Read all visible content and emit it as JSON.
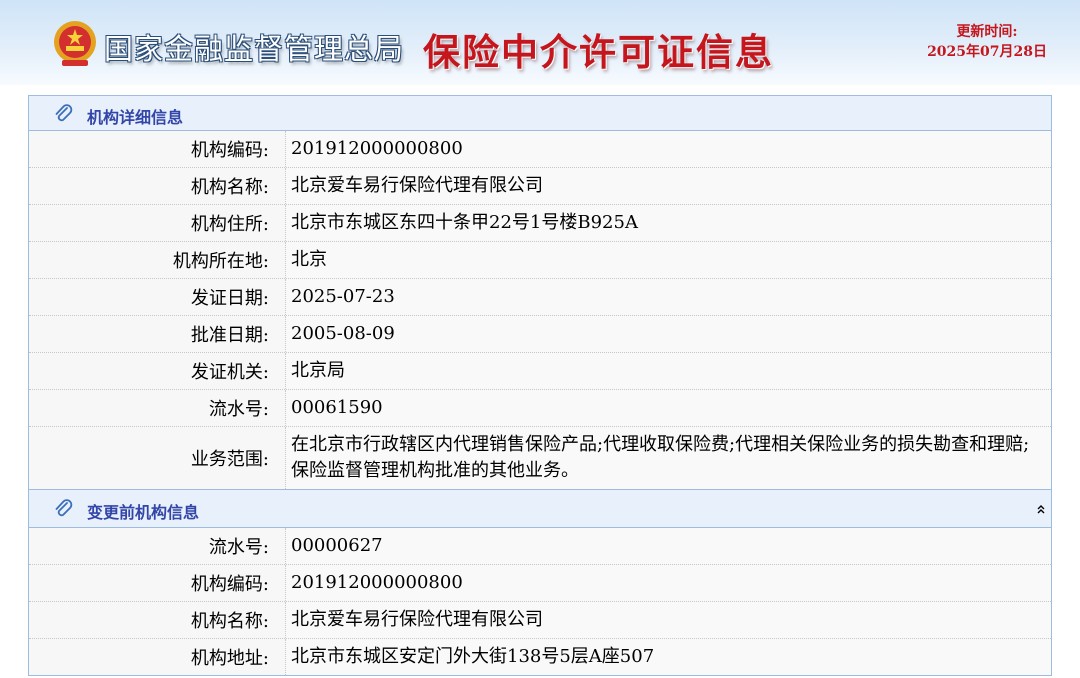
{
  "header": {
    "agency": "国家金融监督管理总局",
    "title": "保险中介许可证信息",
    "update_label": "更新时间:",
    "update_date": "2025年07月28日"
  },
  "detail": {
    "heading": "机构详细信息",
    "rows": [
      {
        "label": "机构编码:",
        "value": "201912000000800"
      },
      {
        "label": "机构名称:",
        "value": "北京爱车易行保险代理有限公司"
      },
      {
        "label": "机构住所:",
        "value": "北京市东城区东四十条甲22号1号楼B925A"
      },
      {
        "label": "机构所在地:",
        "value": "北京"
      },
      {
        "label": "发证日期:",
        "value": "2025-07-23"
      },
      {
        "label": "批准日期:",
        "value": "2005-08-09"
      },
      {
        "label": "发证机关:",
        "value": "北京局"
      },
      {
        "label": "流水号:",
        "value": "00061590"
      },
      {
        "label": "业务范围:",
        "value": "在北京市行政辖区内代理销售保险产品;代理收取保险费;代理相关保险业务的损失勘查和理赔;保险监督管理机构批准的其他业务。"
      }
    ]
  },
  "previous": {
    "heading": "变更前机构信息",
    "rows": [
      {
        "label": "流水号:",
        "value": "00000627"
      },
      {
        "label": "机构编码:",
        "value": "201912000000800"
      },
      {
        "label": "机构名称:",
        "value": "北京爱车易行保险代理有限公司"
      },
      {
        "label": "机构地址:",
        "value": "北京市东城区安定门外大街138号5层A座507"
      }
    ]
  },
  "colors": {
    "title_red": "#c4161c",
    "heading_blue": "#3346a8",
    "panel_border": "#9cbce0"
  }
}
